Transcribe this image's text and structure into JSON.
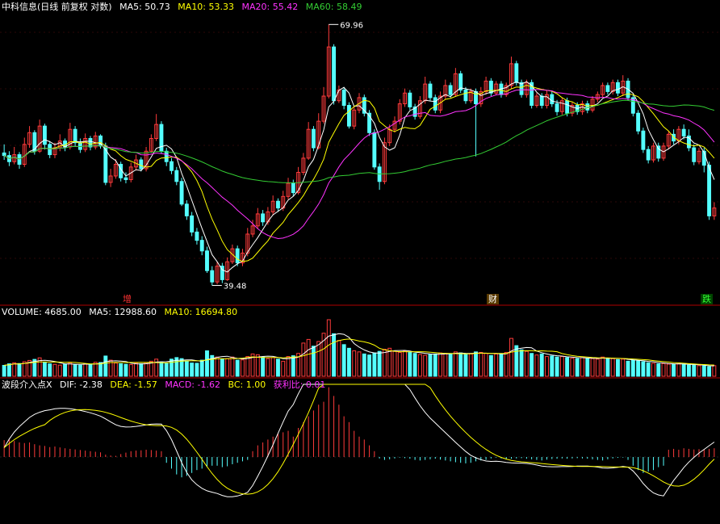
{
  "colors": {
    "bg": "#000000",
    "up": "#ff3b3b",
    "down": "#54ffff",
    "ma5": "#ffffff",
    "ma10": "#ffff00",
    "ma20": "#ff33ff",
    "ma60": "#33cc33",
    "legend_white": "#ffffff",
    "separator": "#b00000",
    "grid": "#5a1010"
  },
  "title_line": {
    "stock": "中科信息(日线 前复权 对数)",
    "ma5": "MA5: 50.73",
    "ma10": "MA10: 53.33",
    "ma20": "MA20: 55.42",
    "ma60": "MA60: 58.49"
  },
  "volume_line": {
    "label": "VOLUME: 4685.00",
    "ma5": "MA5: 12988.60",
    "ma10": "MA10: 16694.80"
  },
  "macd_line": {
    "name": "波段介入点X",
    "dif": "DIF: -2.38",
    "dea": "DEA: -1.57",
    "macd": "MACD: -1.62",
    "bc": "BC: 1.00",
    "profit": "获利比: 0.01"
  },
  "tags": {
    "zeng": "增",
    "caicai": "财",
    "die": "跌"
  },
  "chart_data": {
    "type": "candlestick",
    "price_axis": {
      "scale": "log",
      "ylim": [
        38.5,
        71.5
      ]
    },
    "high_label": "69.96",
    "low_label": "39.48",
    "candles": [
      [
        52.8,
        52.5,
        53.8,
        52.0
      ],
      [
        52.5,
        51.8,
        53.0,
        51.3
      ],
      [
        51.8,
        52.6,
        53.5,
        51.5
      ],
      [
        52.6,
        51.5,
        52.9,
        51.0
      ],
      [
        51.5,
        53.8,
        54.6,
        51.2
      ],
      [
        53.8,
        55.2,
        56.0,
        53.4
      ],
      [
        55.2,
        53.0,
        55.5,
        52.6
      ],
      [
        53.0,
        56.0,
        56.8,
        52.8
      ],
      [
        56.0,
        53.8,
        56.3,
        53.2
      ],
      [
        53.8,
        52.6,
        54.2,
        52.2
      ],
      [
        52.6,
        53.4,
        54.0,
        52.2
      ],
      [
        53.4,
        54.2,
        55.0,
        53.0
      ],
      [
        54.2,
        53.5,
        54.5,
        53.0
      ],
      [
        53.5,
        55.6,
        56.4,
        53.2
      ],
      [
        55.6,
        54.0,
        56.0,
        53.6
      ],
      [
        54.0,
        53.2,
        54.5,
        52.8
      ],
      [
        53.2,
        54.5,
        55.1,
        52.9
      ],
      [
        54.5,
        53.5,
        54.8,
        53.1
      ],
      [
        53.5,
        54.8,
        55.3,
        53.2
      ],
      [
        54.8,
        53.6,
        55.0,
        53.3
      ],
      [
        53.6,
        49.5,
        54.0,
        49.2
      ],
      [
        49.5,
        50.2,
        51.0,
        49.0
      ],
      [
        50.2,
        51.5,
        52.1,
        49.9
      ],
      [
        51.5,
        50.0,
        51.8,
        49.6
      ],
      [
        50.0,
        49.8,
        50.6,
        49.4
      ],
      [
        49.8,
        51.2,
        51.7,
        49.5
      ],
      [
        51.2,
        52.0,
        52.6,
        50.8
      ],
      [
        52.0,
        51.0,
        52.3,
        50.7
      ],
      [
        51.0,
        53.0,
        53.5,
        50.7
      ],
      [
        53.0,
        54.5,
        55.0,
        52.8
      ],
      [
        54.5,
        56.2,
        57.5,
        54.2
      ],
      [
        56.2,
        53.0,
        56.6,
        52.7
      ],
      [
        53.0,
        51.8,
        53.4,
        51.3
      ],
      [
        51.8,
        50.8,
        52.2,
        50.4
      ],
      [
        50.8,
        49.6,
        51.2,
        49.2
      ],
      [
        49.6,
        47.2,
        50.0,
        47.0
      ],
      [
        47.2,
        46.0,
        47.6,
        45.6
      ],
      [
        46.0,
        44.4,
        46.4,
        44.0
      ],
      [
        44.4,
        43.6,
        44.8,
        43.2
      ],
      [
        43.6,
        42.6,
        44.0,
        42.2
      ],
      [
        42.6,
        40.8,
        43.0,
        40.6
      ],
      [
        40.8,
        39.8,
        41.2,
        39.5
      ],
      [
        39.8,
        41.2,
        41.6,
        39.6
      ],
      [
        41.2,
        40.0,
        41.5,
        39.7
      ],
      [
        40.0,
        41.6,
        42.0,
        39.9
      ],
      [
        41.6,
        42.8,
        43.2,
        41.4
      ],
      [
        42.8,
        41.5,
        43.1,
        41.2
      ],
      [
        41.5,
        42.4,
        42.8,
        41.2
      ],
      [
        42.4,
        44.2,
        44.8,
        42.1
      ],
      [
        44.2,
        45.0,
        45.6,
        43.9
      ],
      [
        45.0,
        46.2,
        46.8,
        44.7
      ],
      [
        46.2,
        45.4,
        46.6,
        45.0
      ],
      [
        45.4,
        46.4,
        46.9,
        45.1
      ],
      [
        46.4,
        47.5,
        48.1,
        46.1
      ],
      [
        47.5,
        46.8,
        47.8,
        46.4
      ],
      [
        46.8,
        48.0,
        48.6,
        46.5
      ],
      [
        48.0,
        49.4,
        50.0,
        47.7
      ],
      [
        49.4,
        48.4,
        49.8,
        48.0
      ],
      [
        48.4,
        50.6,
        51.2,
        48.2
      ],
      [
        50.6,
        52.2,
        52.8,
        50.3
      ],
      [
        52.2,
        55.6,
        56.5,
        52.0
      ],
      [
        55.6,
        53.4,
        56.0,
        53.0
      ],
      [
        53.4,
        56.6,
        57.6,
        53.2
      ],
      [
        56.6,
        59.8,
        61.0,
        56.3
      ],
      [
        59.8,
        66.6,
        69.96,
        59.5
      ],
      [
        66.6,
        59.2,
        67.0,
        58.7
      ],
      [
        59.2,
        60.6,
        61.2,
        58.9
      ],
      [
        60.6,
        58.6,
        61.0,
        58.1
      ],
      [
        58.6,
        56.0,
        59.0,
        55.7
      ],
      [
        56.0,
        58.0,
        58.6,
        55.6
      ],
      [
        58.0,
        59.6,
        60.2,
        57.6
      ],
      [
        59.6,
        57.6,
        60.0,
        57.2
      ],
      [
        57.6,
        55.2,
        58.0,
        54.8
      ],
      [
        55.2,
        51.2,
        55.6,
        50.9
      ],
      [
        51.2,
        49.6,
        51.6,
        48.7
      ],
      [
        49.6,
        54.0,
        54.6,
        49.3
      ],
      [
        54.0,
        55.6,
        56.2,
        53.6
      ],
      [
        55.6,
        56.6,
        57.2,
        55.2
      ],
      [
        56.6,
        58.8,
        59.4,
        56.2
      ],
      [
        58.8,
        60.2,
        60.8,
        58.4
      ],
      [
        60.2,
        58.4,
        60.6,
        58.0
      ],
      [
        58.4,
        57.2,
        58.8,
        56.8
      ],
      [
        57.2,
        59.2,
        59.8,
        56.9
      ],
      [
        59.2,
        61.4,
        62.4,
        58.8
      ],
      [
        61.4,
        59.6,
        61.8,
        59.2
      ],
      [
        59.6,
        58.0,
        60.0,
        57.6
      ],
      [
        58.0,
        59.8,
        60.4,
        57.6
      ],
      [
        59.8,
        61.2,
        62.0,
        59.4
      ],
      [
        61.2,
        60.0,
        61.6,
        59.6
      ],
      [
        60.0,
        62.8,
        63.6,
        59.7
      ],
      [
        62.8,
        60.6,
        63.2,
        60.2
      ],
      [
        60.6,
        59.2,
        61.0,
        58.8
      ],
      [
        59.2,
        60.4,
        60.8,
        58.9
      ],
      [
        60.4,
        58.8,
        60.8,
        52.4
      ],
      [
        58.8,
        60.4,
        61.0,
        58.4
      ],
      [
        60.4,
        61.8,
        62.4,
        60.0
      ],
      [
        61.8,
        60.2,
        62.2,
        59.8
      ],
      [
        60.2,
        61.4,
        61.8,
        59.9
      ],
      [
        61.4,
        60.0,
        61.8,
        59.6
      ],
      [
        60.0,
        61.2,
        61.6,
        59.7
      ],
      [
        61.2,
        64.2,
        65.2,
        60.8
      ],
      [
        64.2,
        61.6,
        64.6,
        61.2
      ],
      [
        61.6,
        60.0,
        62.0,
        59.6
      ],
      [
        60.0,
        61.6,
        62.0,
        59.6
      ],
      [
        61.6,
        58.6,
        62.0,
        58.2
      ],
      [
        58.6,
        59.8,
        60.2,
        58.3
      ],
      [
        59.8,
        58.6,
        60.2,
        58.2
      ],
      [
        58.6,
        60.0,
        60.5,
        58.2
      ],
      [
        60.0,
        58.8,
        60.4,
        58.4
      ],
      [
        58.8,
        57.8,
        59.3,
        57.3
      ],
      [
        57.8,
        59.2,
        59.6,
        57.4
      ],
      [
        59.2,
        57.6,
        59.6,
        57.2
      ],
      [
        57.6,
        58.6,
        59.0,
        57.2
      ],
      [
        58.6,
        57.8,
        59.0,
        57.4
      ],
      [
        57.8,
        58.8,
        59.2,
        57.4
      ],
      [
        58.8,
        58.0,
        59.2,
        57.6
      ],
      [
        58.0,
        59.4,
        59.8,
        57.7
      ],
      [
        59.4,
        60.0,
        60.4,
        59.0
      ],
      [
        60.0,
        61.2,
        61.6,
        59.6
      ],
      [
        61.2,
        60.4,
        61.6,
        60.0
      ],
      [
        60.4,
        61.6,
        62.0,
        60.0
      ],
      [
        61.6,
        60.2,
        62.0,
        59.8
      ],
      [
        60.2,
        61.8,
        62.6,
        59.8
      ],
      [
        61.8,
        59.6,
        62.2,
        59.2
      ],
      [
        59.6,
        57.6,
        60.0,
        57.2
      ],
      [
        57.6,
        55.4,
        58.0,
        55.0
      ],
      [
        55.4,
        53.2,
        55.8,
        52.8
      ],
      [
        53.2,
        52.0,
        53.6,
        51.6
      ],
      [
        52.0,
        53.6,
        54.0,
        51.7
      ],
      [
        53.6,
        52.2,
        54.0,
        51.8
      ],
      [
        52.2,
        53.6,
        54.0,
        51.9
      ],
      [
        53.6,
        55.0,
        55.4,
        53.2
      ],
      [
        55.0,
        54.2,
        55.6,
        53.8
      ],
      [
        54.2,
        55.6,
        56.0,
        53.8
      ],
      [
        55.6,
        54.8,
        56.2,
        54.4
      ],
      [
        54.8,
        53.4,
        55.6,
        53.0
      ],
      [
        53.4,
        51.8,
        53.8,
        51.4
      ],
      [
        51.8,
        53.0,
        53.4,
        51.5
      ],
      [
        53.0,
        51.4,
        53.4,
        50.6
      ],
      [
        51.4,
        46.0,
        51.8,
        45.6
      ],
      [
        46.0,
        46.8,
        47.4,
        45.6
      ]
    ],
    "volume": [
      4200,
      4800,
      5200,
      4900,
      5600,
      6100,
      6500,
      7100,
      5400,
      4800,
      4600,
      4300,
      4700,
      5200,
      4400,
      4300,
      4800,
      4700,
      5400,
      5300,
      7800,
      6200,
      5100,
      4800,
      4600,
      4500,
      5000,
      4800,
      5200,
      5800,
      6600,
      5500,
      4900,
      6600,
      7200,
      6800,
      5900,
      5100,
      5000,
      6200,
      9800,
      8000,
      7400,
      6600,
      6800,
      7400,
      6200,
      6300,
      7600,
      8600,
      8300,
      7400,
      6800,
      7200,
      6600,
      5800,
      7600,
      7900,
      8800,
      12800,
      14200,
      11600,
      13400,
      16600,
      21800,
      16400,
      13800,
      12200,
      10800,
      9800,
      9400,
      8600,
      8200,
      9000,
      9600,
      10400,
      10800,
      9600,
      9200,
      9800,
      9200,
      8800,
      8400,
      8100,
      8400,
      8600,
      9000,
      8800,
      8600,
      9400,
      9000,
      8400,
      8600,
      9400,
      9200,
      8800,
      8000,
      8600,
      8400,
      9200,
      14600,
      11800,
      10200,
      9600,
      8800,
      8200,
      8600,
      7600,
      7800,
      7400,
      7600,
      7200,
      7000,
      6800,
      7200,
      7000,
      6800,
      6600,
      7400,
      7000,
      6800,
      6400,
      6600,
      5800,
      6200,
      5900,
      5600,
      5200,
      5000,
      4800,
      4900,
      4700,
      4600,
      4800,
      4700,
      4300,
      4200,
      4100,
      4000,
      3700,
      4100
    ],
    "macd": [
      0.58,
      0.6,
      0.55,
      0.5,
      0.48,
      0.5,
      0.44,
      0.4,
      0.38,
      0.34,
      0.36,
      0.33,
      0.3,
      0.28,
      0.26,
      0.24,
      0.22,
      0.2,
      0.18,
      0.16,
      0.08,
      0.05,
      0.04,
      0.1,
      0.15,
      0.2,
      0.22,
      0.23,
      0.25,
      0.24,
      0.22,
      0.2,
      -0.2,
      -0.4,
      -0.6,
      -0.7,
      -0.65,
      -0.55,
      -0.45,
      -0.4,
      -0.35,
      -0.3,
      -0.3,
      -0.35,
      -0.32,
      -0.25,
      -0.2,
      -0.15,
      -0.1,
      0.2,
      0.4,
      0.5,
      0.6,
      0.7,
      0.8,
      0.85,
      0.9,
      0.7,
      1.0,
      1.2,
      1.4,
      1.6,
      1.8,
      1.9,
      2.4,
      2.1,
      1.8,
      1.4,
      1.2,
      0.9,
      0.7,
      0.6,
      0.4,
      0.2,
      -0.05,
      -0.1,
      -0.08,
      -0.05,
      -0.02,
      -0.04,
      -0.06,
      -0.1,
      -0.12,
      -0.1,
      -0.08,
      -0.06,
      -0.09,
      -0.12,
      -0.15,
      -0.18,
      -0.2,
      -0.22,
      -0.2,
      -0.15,
      -0.12,
      -0.1,
      -0.05,
      -0.02,
      -0.05,
      -0.08,
      -0.06,
      -0.05,
      -0.04,
      -0.06,
      -0.08,
      -0.1,
      -0.12,
      -0.09,
      -0.07,
      -0.06,
      -0.05,
      -0.06,
      -0.05,
      -0.04,
      -0.05,
      -0.06,
      -0.08,
      -0.1,
      -0.12,
      -0.08,
      -0.05,
      -0.03,
      -0.02,
      -0.1,
      -0.3,
      -0.45,
      -0.55,
      -0.5,
      -0.45,
      -0.35,
      -0.3,
      0.25,
      0.28,
      0.25,
      0.3,
      0.28,
      0.26,
      0.27,
      0.25,
      0.28,
      0.3
    ]
  }
}
